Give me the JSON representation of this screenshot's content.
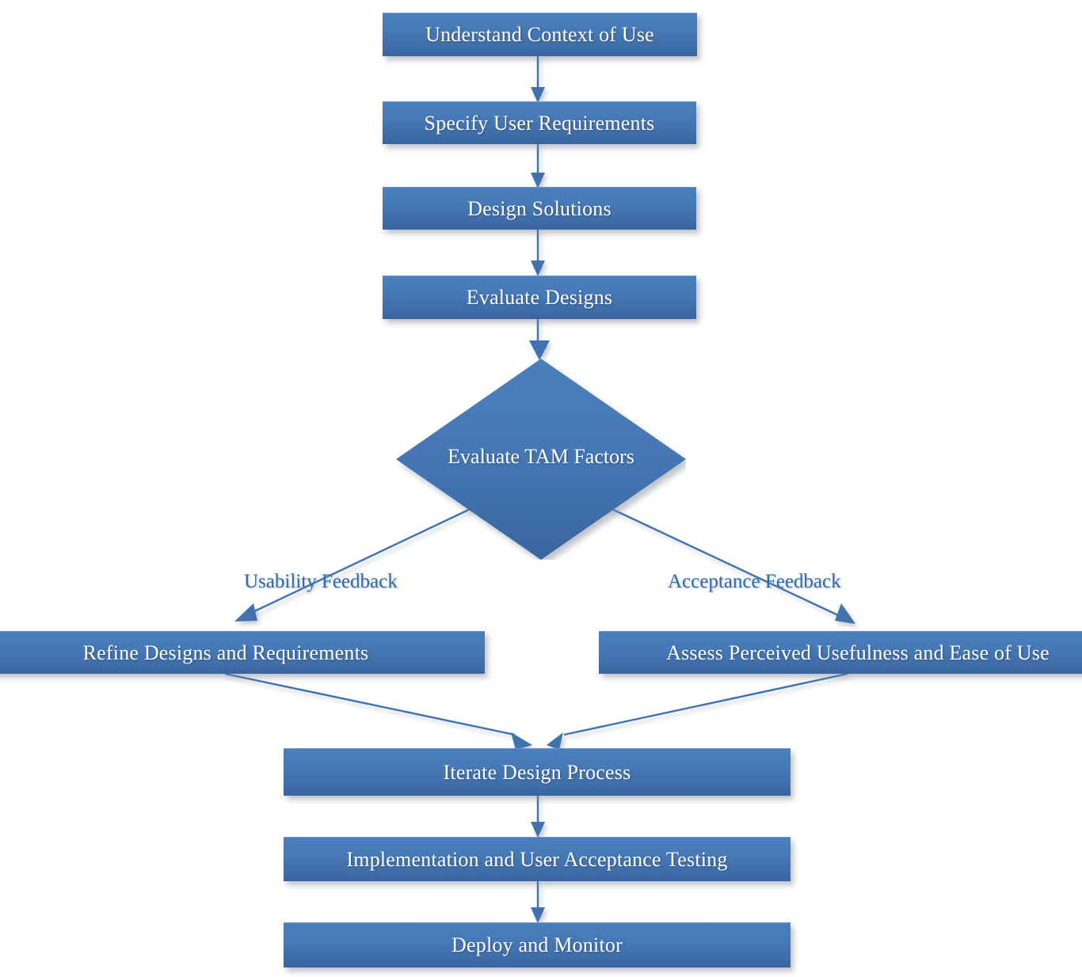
{
  "diagram": {
    "title": "Human-Centred Design process with TAM evaluation",
    "colors": {
      "node_fill_top": "#4a7fbe",
      "node_fill_bottom": "#39659e",
      "node_text": "#ffffff",
      "edge_line": "#3f72b0",
      "edge_label_text": "#2e6bb0",
      "background": "#ffffff"
    },
    "nodes": [
      {
        "id": "understand",
        "label": "Understand Context of Use",
        "shape": "process"
      },
      {
        "id": "specify",
        "label": "Specify User Requirements",
        "shape": "process"
      },
      {
        "id": "design",
        "label": "Design Solutions",
        "shape": "process"
      },
      {
        "id": "evaluate",
        "label": "Evaluate Designs",
        "shape": "process"
      },
      {
        "id": "tam",
        "label": "Evaluate TAM Factors",
        "shape": "decision"
      },
      {
        "id": "refine",
        "label": "Refine Designs and Requirements",
        "shape": "process"
      },
      {
        "id": "assess",
        "label": "Assess Perceived Usefulness and Ease of Use",
        "shape": "process"
      },
      {
        "id": "iterate",
        "label": "Iterate Design Process",
        "shape": "process"
      },
      {
        "id": "implementation",
        "label": "Implementation and User Acceptance Testing",
        "shape": "process"
      },
      {
        "id": "deploy",
        "label": "Deploy and Monitor",
        "shape": "process"
      }
    ],
    "edges": [
      {
        "from": "understand",
        "to": "specify",
        "label": ""
      },
      {
        "from": "specify",
        "to": "design",
        "label": ""
      },
      {
        "from": "design",
        "to": "evaluate",
        "label": ""
      },
      {
        "from": "evaluate",
        "to": "tam",
        "label": ""
      },
      {
        "from": "tam",
        "to": "refine",
        "label": "Usability Feedback"
      },
      {
        "from": "tam",
        "to": "assess",
        "label": "Acceptance Feedback"
      },
      {
        "from": "refine",
        "to": "iterate",
        "label": ""
      },
      {
        "from": "assess",
        "to": "iterate",
        "label": ""
      },
      {
        "from": "iterate",
        "to": "implementation",
        "label": ""
      },
      {
        "from": "implementation",
        "to": "deploy",
        "label": ""
      }
    ],
    "edge_labels": {
      "usability": "Usability Feedback",
      "acceptance": "Acceptance Feedback"
    }
  }
}
